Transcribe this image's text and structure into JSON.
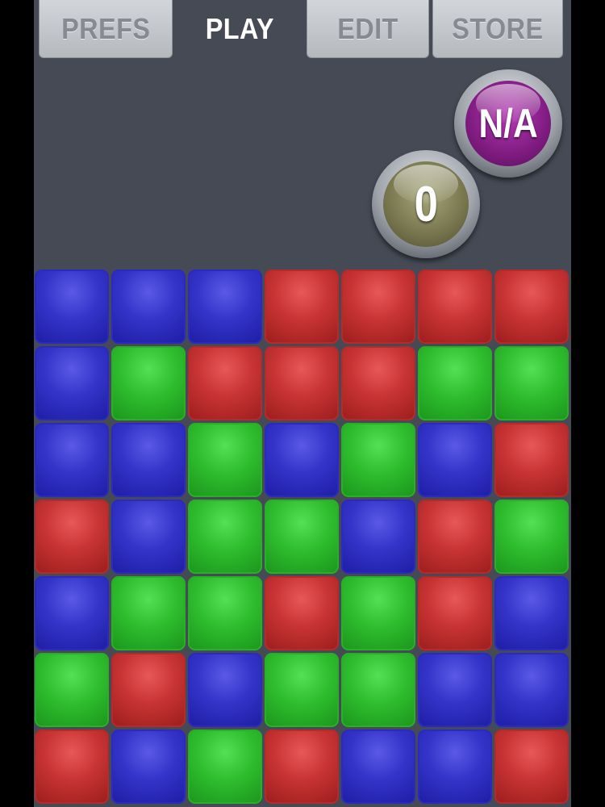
{
  "tabs": [
    {
      "label": "PREFS",
      "active": false
    },
    {
      "label": "PLAY",
      "active": true
    },
    {
      "label": "EDIT",
      "active": false
    },
    {
      "label": "STORE",
      "active": false
    }
  ],
  "scores": {
    "best": "N/A",
    "current": "0"
  },
  "colors": {
    "blue": "#3434c9",
    "red": "#c83434",
    "green": "#2fbf2f",
    "background": "#454a55"
  },
  "board": {
    "rows": [
      [
        "blue",
        "blue",
        "blue",
        "red",
        "red",
        "red",
        "red"
      ],
      [
        "blue",
        "green",
        "red",
        "red",
        "red",
        "green",
        "green"
      ],
      [
        "blue",
        "blue",
        "green",
        "blue",
        "green",
        "blue",
        "red"
      ],
      [
        "red",
        "blue",
        "green",
        "green",
        "blue",
        "red",
        "green"
      ],
      [
        "blue",
        "green",
        "green",
        "red",
        "green",
        "red",
        "blue"
      ],
      [
        "green",
        "red",
        "blue",
        "green",
        "green",
        "blue",
        "blue"
      ],
      [
        "red",
        "blue",
        "green",
        "red",
        "blue",
        "blue",
        "red"
      ]
    ]
  }
}
